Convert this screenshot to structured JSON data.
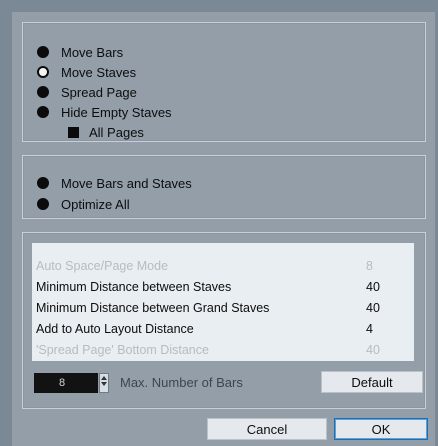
{
  "layout_options": {
    "move_bars": {
      "label": "Move Bars",
      "state": "filled"
    },
    "move_staves": {
      "label": "Move Staves",
      "state": "hollow"
    },
    "spread_page": {
      "label": "Spread Page",
      "state": "filled"
    },
    "hide_empty_staves": {
      "label": "Hide Empty Staves",
      "state": "filled"
    },
    "all_pages": {
      "label": "All Pages",
      "checked": true
    }
  },
  "optimize_options": {
    "move_bars_and_staves": {
      "label": "Move Bars and Staves"
    },
    "optimize_all": {
      "label": "Optimize All"
    }
  },
  "parameters": [
    {
      "label": "Auto Space/Page Mode",
      "value": "8",
      "disabled": true
    },
    {
      "label": "Minimum Distance between Staves",
      "value": "40",
      "disabled": false
    },
    {
      "label": "Minimum Distance between Grand Staves",
      "value": "40",
      "disabled": false
    },
    {
      "label": "Add to Auto Layout Distance",
      "value": "4",
      "disabled": false
    },
    {
      "label": "'Spread Page' Bottom Distance",
      "value": "40",
      "disabled": true
    }
  ],
  "max_bars": {
    "value": "8",
    "label": "Max. Number of Bars"
  },
  "buttons": {
    "default": "Default",
    "cancel": "Cancel",
    "ok": "OK"
  },
  "icons": {
    "radio_filled": "radio-filled-icon",
    "radio_hollow": "radio-hollow-icon",
    "checkbox": "checkbox-icon"
  }
}
